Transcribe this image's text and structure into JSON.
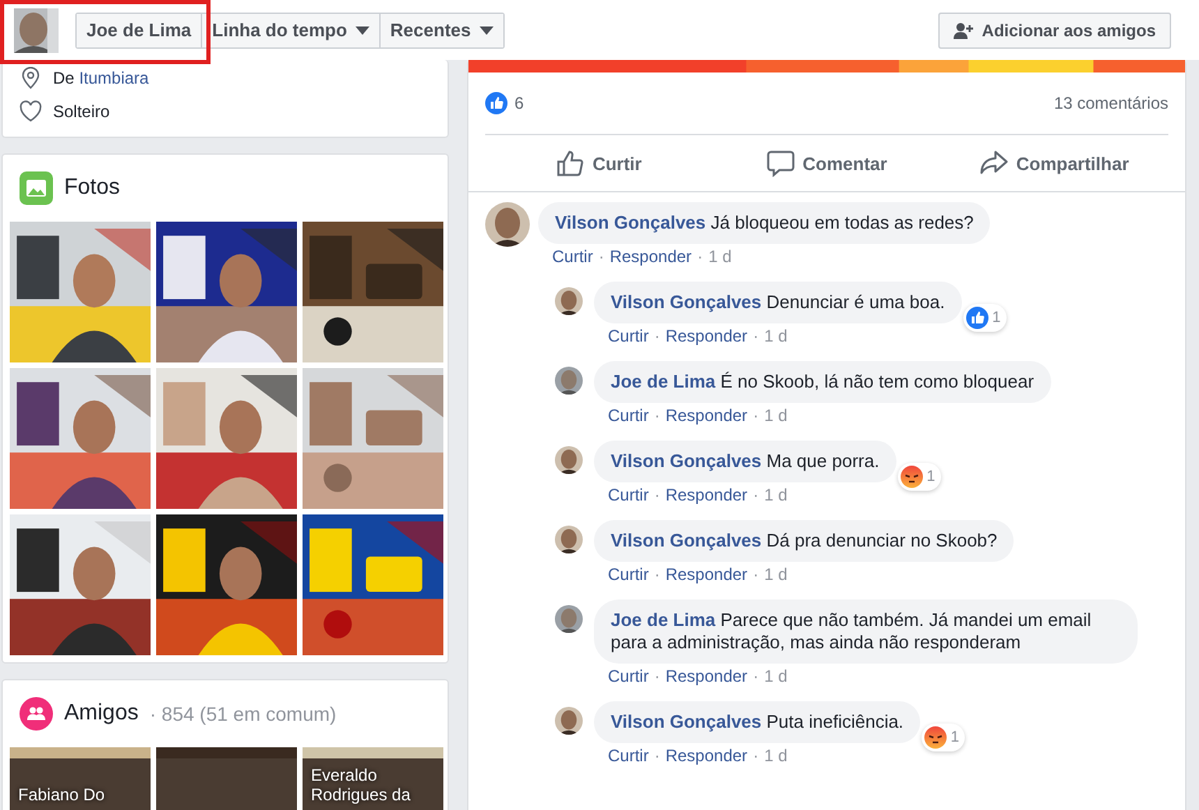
{
  "header": {
    "profile_highlighted": true,
    "name_tab": "Joe de Lima",
    "tabs": [
      {
        "label": "Linha do tempo"
      },
      {
        "label": "Recentes"
      }
    ],
    "add_friend_button": "Adicionar aos amigos"
  },
  "intro": {
    "items": [
      {
        "kind": "place",
        "prefix": "De",
        "link": "Itumbiara"
      },
      {
        "kind": "relationship",
        "text": "Solteiro"
      }
    ]
  },
  "photos": {
    "title": "Fotos",
    "items": [
      {
        "kind": "picture"
      },
      {
        "kind": "picture"
      },
      {
        "kind": "picture"
      },
      {
        "kind": "picture"
      },
      {
        "kind": "picture"
      },
      {
        "kind": "picture"
      },
      {
        "kind": "picture"
      },
      {
        "kind": "picture"
      },
      {
        "kind": "picture"
      }
    ]
  },
  "friends": {
    "title": "Amigos",
    "count": "· 854 (51 em comum)",
    "items": [
      {
        "kind": "picture",
        "name": "Fabiano Do"
      },
      {
        "kind": "picture"
      },
      {
        "kind": "picture",
        "name": "Everaldo Rodrigues da"
      }
    ]
  },
  "post": {
    "likes": "6",
    "comments_count": "13 comentários",
    "actions": [
      {
        "kind": "like",
        "label": "Curtir"
      },
      {
        "kind": "comment",
        "label": "Comentar"
      },
      {
        "kind": "share",
        "label": "Compartilhar"
      }
    ],
    "comments": [
      {
        "author": "Vilson Gonçalves",
        "text": "Já bloqueou em todas as redes?",
        "meta": [
          "Curtir",
          "·",
          "Responder",
          "·",
          "1 d"
        ],
        "replies": [
          {
            "author": "Vilson Gonçalves",
            "text": "Denunciar é uma boa.",
            "meta": [
              "Curtir",
              "·",
              "Responder",
              "·",
              "1 d"
            ],
            "reaction": {
              "kind": "like",
              "count": "1"
            }
          },
          {
            "author": "Joe de Lima",
            "text": "É no Skoob, lá não tem como bloquear",
            "meta": [
              "Curtir",
              "·",
              "Responder",
              "·",
              "1 d"
            ]
          },
          {
            "author": "Vilson Gonçalves",
            "text": "Ma que porra.",
            "meta": [
              "Curtir",
              "·",
              "Responder",
              "·",
              "1 d"
            ],
            "reaction": {
              "kind": "angry",
              "count": "1"
            }
          },
          {
            "author": "Vilson Gonçalves",
            "text": "Dá pra denunciar no Skoob?",
            "meta": [
              "Curtir",
              "·",
              "Responder",
              "·",
              "1 d"
            ]
          },
          {
            "author": "Joe de Lima",
            "text": "Parece que não também. Já mandei um email para a administração, mas ainda não responderam",
            "meta": [
              "Curtir",
              "·",
              "Responder",
              "·",
              "1 d"
            ]
          },
          {
            "author": "Vilson Gonçalves",
            "text": "Puta ineficiência.",
            "meta": [
              "Curtir",
              "·",
              "Responder",
              "·",
              "1 d"
            ],
            "reaction": {
              "kind": "angry",
              "count": "1"
            }
          }
        ]
      }
    ]
  }
}
